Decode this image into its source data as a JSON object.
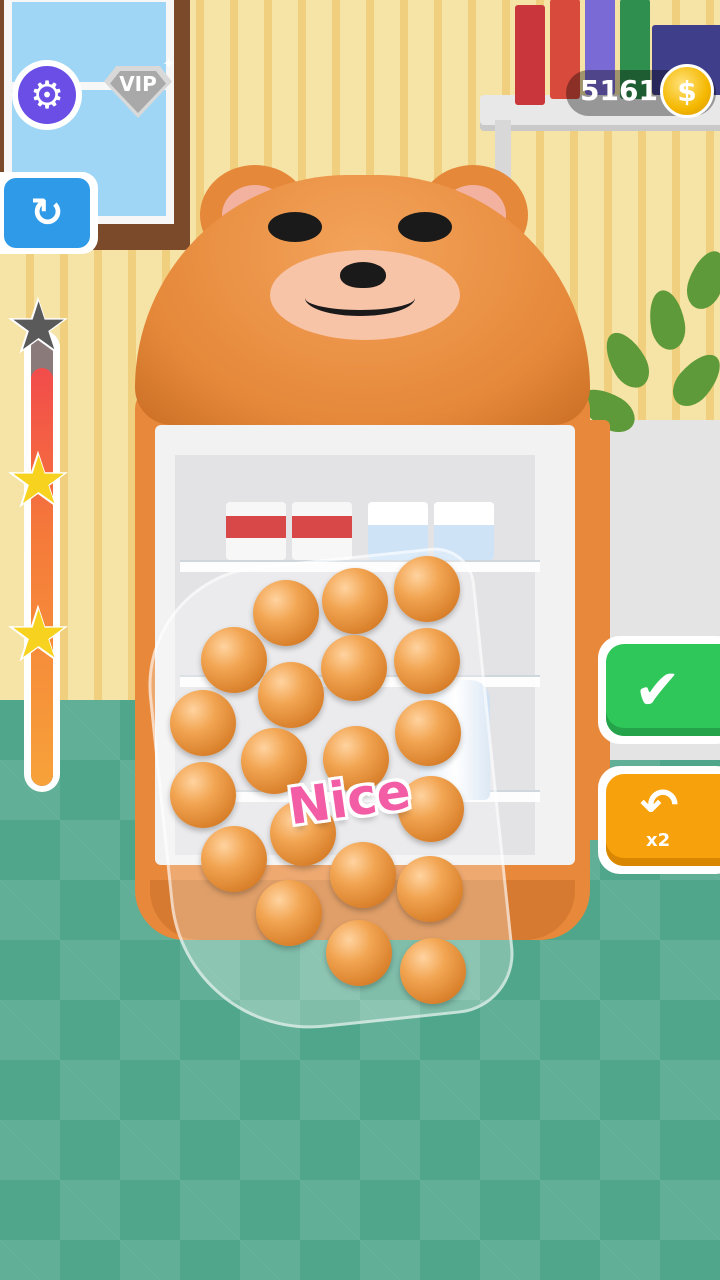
{
  "hud": {
    "vip_label": "VIP",
    "coins": "5161",
    "coin_symbol": "$",
    "settings_icon": "gear-icon",
    "restart_icon": "restart-icon",
    "confirm_icon": "checkmark-icon",
    "undo_icon": "undo-icon",
    "undo_multiplier": "x2"
  },
  "progress": {
    "stars_earned": 2,
    "stars_total": 3,
    "fill_fraction": 0.93
  },
  "feedback": {
    "message": "Nice"
  },
  "colors": {
    "settings": "#6b4ee6",
    "restart": "#2f9be8",
    "confirm": "#2fc65a",
    "undo": "#f7a10c",
    "feedback": "#f25da6"
  }
}
